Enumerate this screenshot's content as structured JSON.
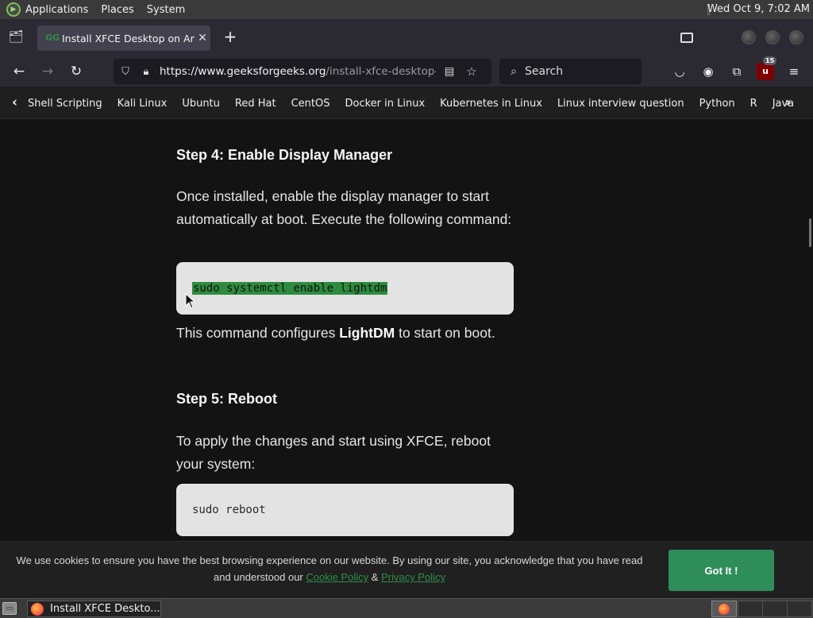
{
  "system_panel": {
    "menus": [
      "Applications",
      "Places",
      "System"
    ],
    "clock": "Wed Oct  9,  7:02 AM"
  },
  "browser": {
    "tab": {
      "title": "Install XFCE Desktop on Arch Linux",
      "favicon": "geeksforgeeks-icon"
    },
    "url_host": "https://www.geeksforgeeks.org",
    "url_path": "/install-xfce-desktop-on-arch-linux/",
    "search_placeholder": "Search",
    "ublock_count": "15"
  },
  "category_nav": {
    "items": [
      "Shell Scripting",
      "Kali Linux",
      "Ubuntu",
      "Red Hat",
      "CentOS",
      "Docker in Linux",
      "Kubernetes in Linux",
      "Linux interview question",
      "Python",
      "R",
      "Java"
    ]
  },
  "article": {
    "step4_title": "Step 4: Enable Display Manager",
    "step4_para": "Once installed, enable the display manager to start automatically at boot. Execute the following command:",
    "step4_code": "sudo systemctl enable lightdm",
    "after_code_pre": "This command configures ",
    "after_code_bold": "LightDM",
    "after_code_post": " to start on boot.",
    "step5_title": "Step 5: Reboot",
    "step5_para": "To apply the changes and start using XFCE, reboot your system:",
    "step5_code": "sudo reboot"
  },
  "cookie_banner": {
    "text_main": "We use cookies to ensure you have the best browsing experience on our website. By using our site, you acknowledge that you have read and understood our",
    "cookie_policy": "Cookie Policy",
    "amp": "&",
    "privacy_policy": "Privacy Policy",
    "button": "Got It !"
  },
  "taskbar": {
    "task_title": "Install XFCE Deskto..."
  },
  "colors": {
    "accent_green": "#2f8d46",
    "selection_green": "#2e8b3e",
    "panel_bg": "#3a3a3a",
    "page_bg": "#131313"
  }
}
